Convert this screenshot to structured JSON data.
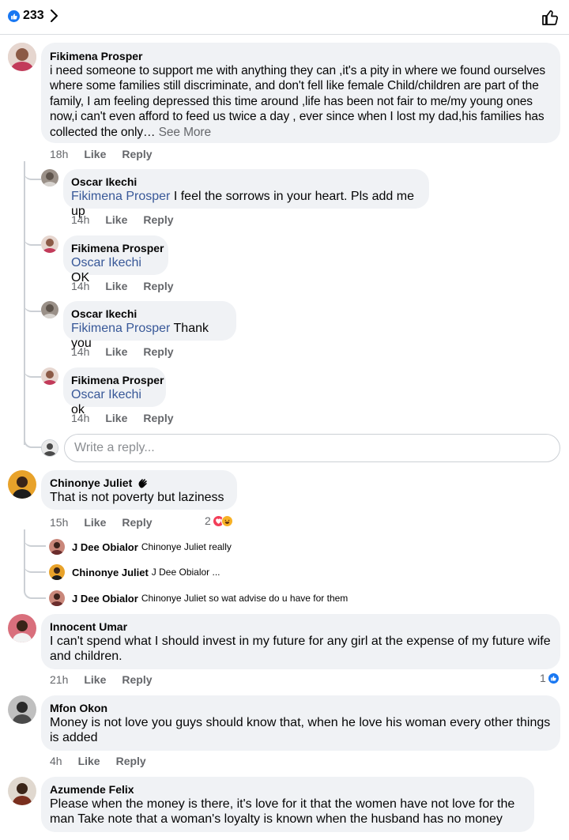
{
  "header": {
    "like_count": "233",
    "colors": {
      "like_blue": "#1877f2",
      "mention": "#385898",
      "meta": "#65676b",
      "bubble": "#f0f2f5"
    }
  },
  "labels": {
    "like": "Like",
    "reply": "Reply",
    "see_more": "See More"
  },
  "comments": [
    {
      "author": "Fikimena Prosper",
      "text": "i need someone to support me with anything they can ,it's a pity in where we found ourselves where some families still discriminate, and don't fell like female Child/children are part of the family,  I am feeling depressed this time around ,life has been not fair to me/my young ones now,i can't even afford to feed us twice a day , ever since when I lost my dad,his families has collected the only…",
      "time": "18h",
      "replies": [
        {
          "author": "Oscar Ikechi",
          "mention": "Fikimena Prosper",
          "text": "I feel the sorrows in your heart. Pls add me up",
          "time": "14h"
        },
        {
          "author": "Fikimena Prosper",
          "mention": "Oscar Ikechi",
          "text": "OK",
          "time": "14h"
        },
        {
          "author": "Oscar Ikechi",
          "mention": "Fikimena Prosper",
          "text": "Thank you",
          "time": "14h"
        },
        {
          "author": "Fikimena Prosper",
          "mention": "Oscar Ikechi",
          "text": "ok",
          "time": "14h"
        }
      ],
      "reply_placeholder": "Write a reply..."
    },
    {
      "author": "Chinonye Juliet",
      "text": "That is not poverty but laziness",
      "time": "15h",
      "reaction_count": "2",
      "reactions": [
        "love",
        "haha"
      ],
      "badge_icon": "waving-hand-icon",
      "mini_replies": [
        {
          "author": "J Dee Obialor",
          "text": "Chinonye Juliet really"
        },
        {
          "author": "Chinonye Juliet",
          "text": "J Dee Obialor ..."
        },
        {
          "author": "J Dee Obialor",
          "text": "Chinonye Juliet so wat advise do u have for them"
        }
      ]
    },
    {
      "author": "Innocent Umar",
      "text": "I can't spend what I should invest in my future for any girl at the expense of my future wife and children.",
      "time": "21h",
      "reaction_count": "1",
      "reactions": [
        "like"
      ]
    },
    {
      "author": "Mfon Okon",
      "text": "Money is not love you guys should know that, when he love his woman every other things is added",
      "time": "4h"
    },
    {
      "author": "Azumende Felix",
      "text": "Please when the money is there, it's love for it that the women have not love for the man Take note that a woman's loyalty is known when the husband has no money"
    }
  ]
}
